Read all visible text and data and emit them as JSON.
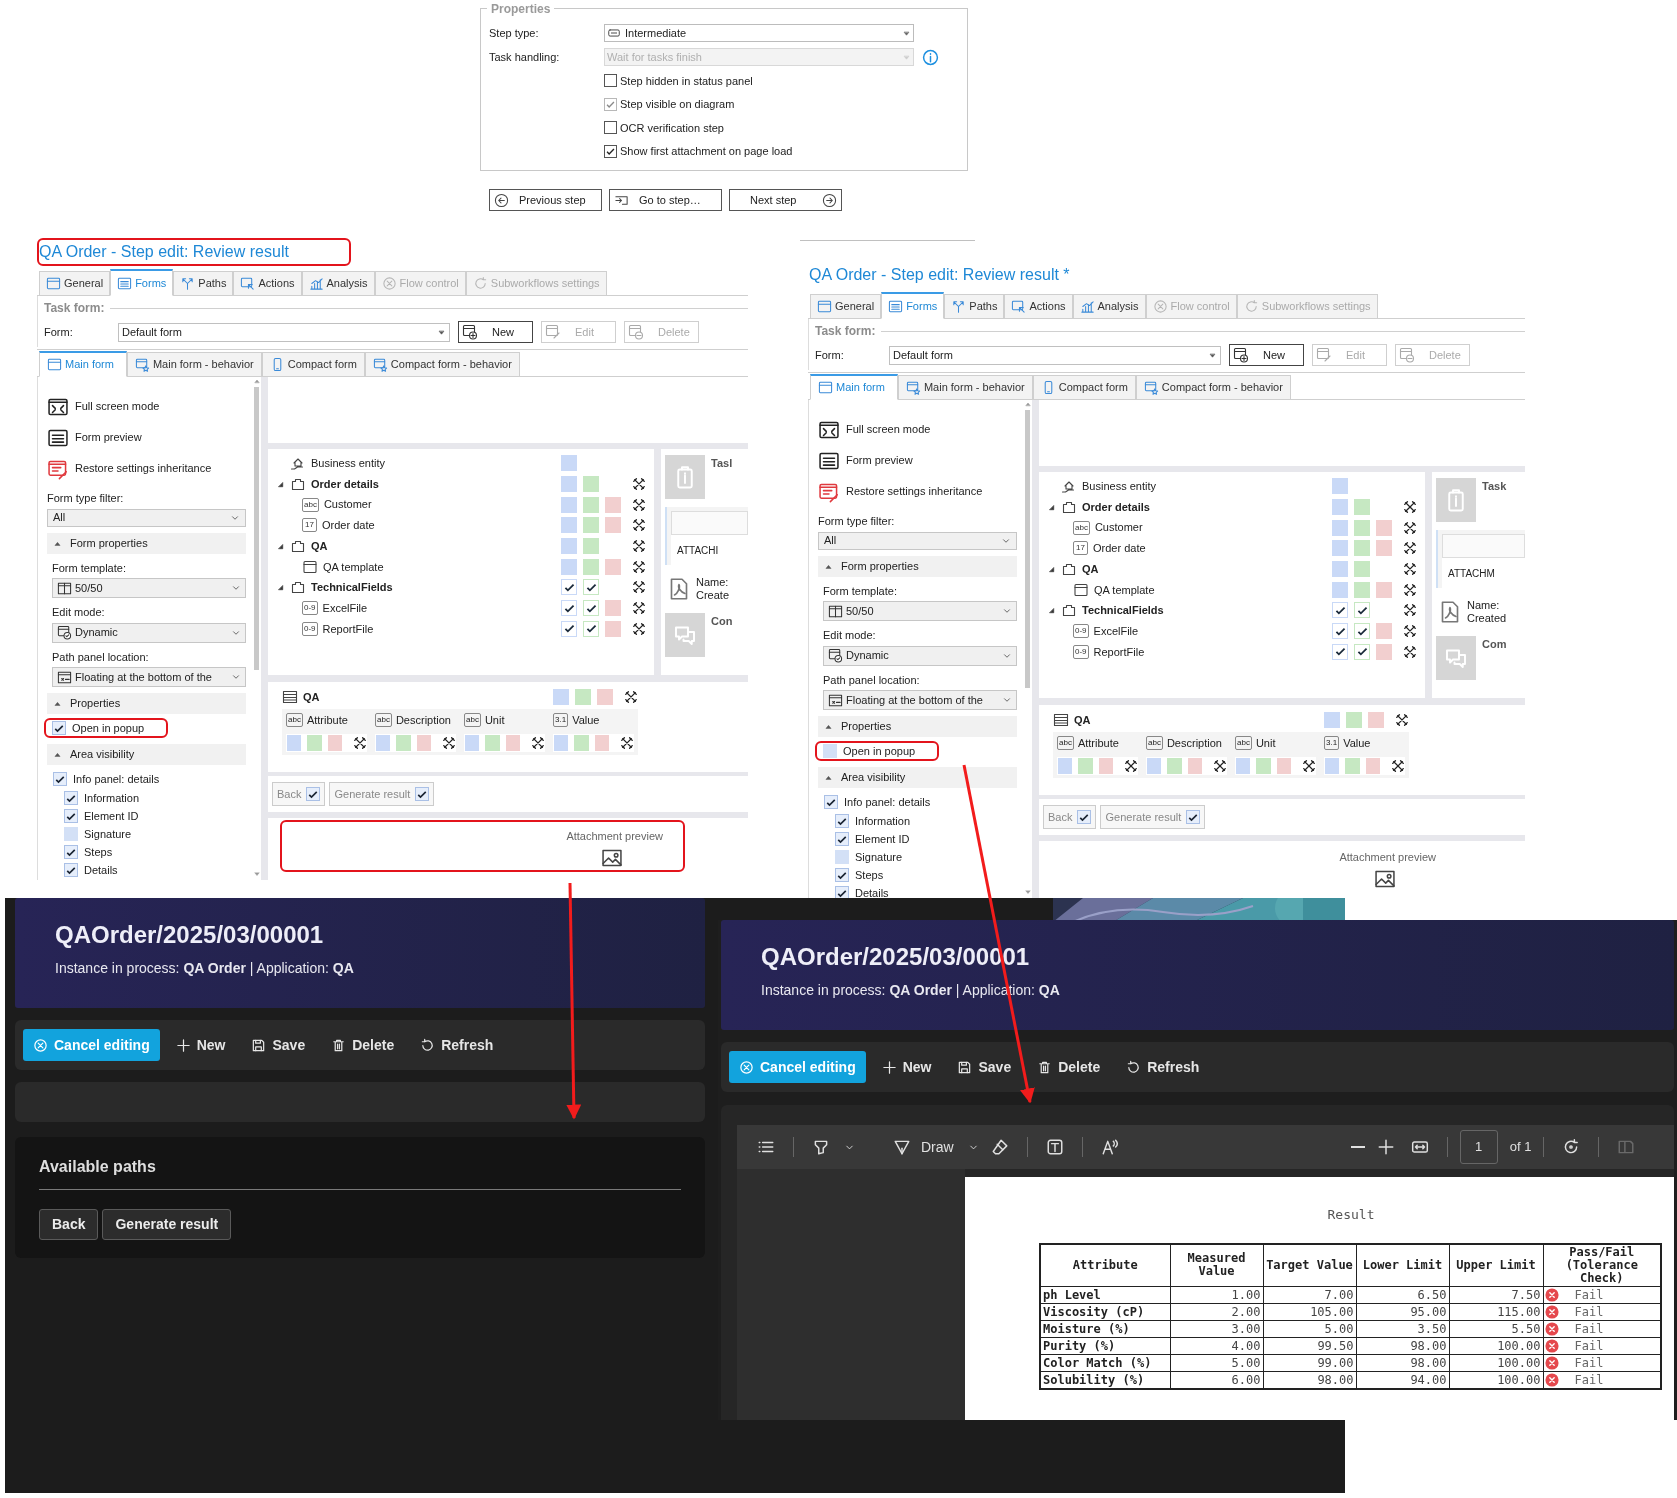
{
  "properties_panel": {
    "legend": "Properties",
    "fields": [
      {
        "label": "Step type:",
        "value": "Intermediate",
        "disabled": false,
        "info": false
      },
      {
        "label": "Task handling:",
        "value": "Wait for tasks finish",
        "disabled": true,
        "info": true
      }
    ],
    "checkboxes": [
      {
        "label": "Step hidden in status panel",
        "checked": false,
        "disabled": false
      },
      {
        "label": "Step visible on diagram",
        "checked": true,
        "disabled": true
      },
      {
        "label": "OCR verification step",
        "checked": false,
        "disabled": false
      },
      {
        "label": "Show first attachment on page load",
        "checked": true,
        "disabled": false
      }
    ],
    "buttons": [
      {
        "label": "Previous step",
        "kind": "prev"
      },
      {
        "label": "Go to step…",
        "kind": "goto"
      },
      {
        "label": "Next step",
        "kind": "next"
      }
    ]
  },
  "editor_panels": [
    {
      "title": "QA Order - Step edit: Review result",
      "title_highlighted": true,
      "tabs": [
        {
          "label": "General",
          "kind": "general",
          "selected": false,
          "disabled": false
        },
        {
          "label": "Forms",
          "kind": "forms",
          "selected": true,
          "disabled": false
        },
        {
          "label": "Paths",
          "kind": "paths",
          "selected": false,
          "disabled": false
        },
        {
          "label": "Actions",
          "kind": "actions",
          "selected": false,
          "disabled": false
        },
        {
          "label": "Analysis",
          "kind": "analysis",
          "selected": false,
          "disabled": false
        },
        {
          "label": "Flow control",
          "kind": "flow",
          "selected": false,
          "disabled": true
        },
        {
          "label": "Subworkflows settings",
          "kind": "subworkflows",
          "selected": false,
          "disabled": true
        }
      ],
      "task_form": {
        "heading": "Task form:",
        "label": "Form:",
        "value": "Default form",
        "buttons": [
          {
            "label": "New",
            "kind": "new",
            "disabled": false
          },
          {
            "label": "Edit",
            "kind": "edit",
            "disabled": true
          },
          {
            "label": "Delete",
            "kind": "delete",
            "disabled": true
          }
        ]
      },
      "subtabs": [
        {
          "label": "Main form",
          "kind": "main",
          "selected": true
        },
        {
          "label": "Main form - behavior",
          "kind": "behavior",
          "selected": false
        },
        {
          "label": "Compact form",
          "kind": "compact",
          "selected": false
        },
        {
          "label": "Compact form - behavior",
          "kind": "compact_behavior",
          "selected": false
        }
      ],
      "sidebar": {
        "actions": [
          {
            "label": "Full screen mode",
            "kind": "fullscreen"
          },
          {
            "label": "Form preview",
            "kind": "preview"
          },
          {
            "label": "Restore settings inheritance",
            "kind": "restore"
          }
        ],
        "filter": {
          "label": "Form type filter:",
          "value": "All"
        },
        "sections": [
          {
            "title": "Form properties",
            "expanded": true,
            "fields": [
              {
                "label": "Form template:",
                "value": "50/50",
                "kind": "template"
              },
              {
                "label": "Edit mode:",
                "value": "Dynamic",
                "kind": "mode"
              },
              {
                "label": "Path panel location:",
                "value": "Floating at the bottom of the",
                "kind": "location"
              }
            ]
          },
          {
            "title": "Properties",
            "expanded": true,
            "checks": [
              {
                "label": "Open in popup",
                "checked": true,
                "highlighted": true
              }
            ]
          },
          {
            "title": "Area visibility",
            "expanded": true,
            "checks": [
              {
                "label": "Info panel: details",
                "checked": true,
                "highlighted": false,
                "children": [
                  {
                    "label": "Information",
                    "checked": true
                  },
                  {
                    "label": "Element ID",
                    "checked": true
                  },
                  {
                    "label": "Signature",
                    "checked": false
                  },
                  {
                    "label": "Steps",
                    "checked": true
                  },
                  {
                    "label": "Details",
                    "checked": true
                  }
                ]
              }
            ]
          }
        ]
      },
      "fields_tree": [
        {
          "label": "Business entity",
          "kind": "entity",
          "tools": false,
          "flags": [
            {
              "color": "#c9d9f7",
              "checked": false
            }
          ]
        },
        {
          "label": "Order details",
          "kind": "group",
          "expanded": true,
          "tools": true,
          "flags": [
            {
              "color": "#c9d9f7",
              "checked": false
            },
            {
              "color": "#c6e8c2",
              "checked": false
            }
          ],
          "children": [
            {
              "label": "Customer",
              "kind": "field",
              "badge": "abc",
              "tools": true,
              "flags": [
                {
                  "color": "#c9d9f7",
                  "checked": false
                },
                {
                  "color": "#c6e8c2",
                  "checked": false
                },
                {
                  "color": "#f2cfcf",
                  "checked": false
                }
              ]
            },
            {
              "label": "Order date",
              "kind": "field",
              "badge": "17",
              "tools": true,
              "flags": [
                {
                  "color": "#c9d9f7",
                  "checked": false
                },
                {
                  "color": "#c6e8c2",
                  "checked": false
                },
                {
                  "color": "#f2cfcf",
                  "checked": false
                }
              ]
            }
          ]
        },
        {
          "label": "QA",
          "kind": "group",
          "expanded": true,
          "tools": true,
          "flags": [
            {
              "color": "#c9d9f7",
              "checked": false
            },
            {
              "color": "#c6e8c2",
              "checked": false
            }
          ],
          "children": [
            {
              "label": "QA template",
              "kind": "template",
              "tools": true,
              "flags": [
                {
                  "color": "#c9d9f7",
                  "checked": false
                },
                {
                  "color": "#c6e8c2",
                  "checked": false
                },
                {
                  "color": "#f2cfcf",
                  "checked": false
                }
              ]
            }
          ]
        },
        {
          "label": "TechnicalFields",
          "kind": "group",
          "expanded": true,
          "tools": true,
          "flags": [
            {
              "color": "#c9d9f7",
              "checked": true
            },
            {
              "color": "#c6e8c2",
              "checked": true
            }
          ],
          "children": [
            {
              "label": "ExcelFile",
              "kind": "field",
              "badge": "0-9",
              "tools": true,
              "flags": [
                {
                  "color": "#c9d9f7",
                  "checked": true
                },
                {
                  "color": "#c6e8c2",
                  "checked": true
                },
                {
                  "color": "#f2cfcf",
                  "checked": false
                }
              ]
            },
            {
              "label": "ReportFile",
              "kind": "field",
              "badge": "0-9",
              "tools": true,
              "flags": [
                {
                  "color": "#c9d9f7",
                  "checked": true
                },
                {
                  "color": "#c6e8c2",
                  "checked": true
                },
                {
                  "color": "#f2cfcf",
                  "checked": false
                }
              ]
            }
          ]
        }
      ],
      "info_panel": {
        "task_heading": "Tasl",
        "attachments_heading": "ATTACHI",
        "name_label": "Name:",
        "created_label": "Create",
        "comments_heading": "Con"
      },
      "qa_table": {
        "title": "QA",
        "tools": true,
        "flags": [
          {
            "color": "#c9d9f7",
            "checked": false
          },
          {
            "color": "#c6e8c2",
            "checked": false
          },
          {
            "color": "#f2cfcf",
            "checked": false
          }
        ],
        "columns": [
          {
            "label": "Attribute",
            "badge": "abc",
            "tools": true,
            "flags": [
              {
                "color": "#c9d9f7",
                "checked": false
              },
              {
                "color": "#c6e8c2",
                "checked": false
              },
              {
                "color": "#f2cfcf",
                "checked": false
              }
            ]
          },
          {
            "label": "Description",
            "badge": "abc",
            "tools": true,
            "flags": [
              {
                "color": "#c9d9f7",
                "checked": false
              },
              {
                "color": "#c6e8c2",
                "checked": false
              },
              {
                "color": "#f2cfcf",
                "checked": false
              }
            ]
          },
          {
            "label": "Unit",
            "badge": "abc",
            "tools": true,
            "flags": [
              {
                "color": "#c9d9f7",
                "checked": false
              },
              {
                "color": "#c6e8c2",
                "checked": false
              },
              {
                "color": "#f2cfcf",
                "checked": false
              }
            ]
          },
          {
            "label": "Value",
            "badge": "3.1",
            "tools": true,
            "flags": [
              {
                "color": "#c9d9f7",
                "checked": false
              },
              {
                "color": "#c6e8c2",
                "checked": false
              },
              {
                "color": "#f2cfcf",
                "checked": false
              }
            ]
          }
        ]
      },
      "path_buttons": [
        {
          "label": "Back",
          "checked": true
        },
        {
          "label": "Generate result",
          "checked": true
        }
      ],
      "attachment_preview": {
        "label": "Attachment preview",
        "highlighted": true
      }
    },
    {
      "title": "QA Order - Step edit: Review result *",
      "title_highlighted": false,
      "tabs": [
        {
          "label": "General",
          "kind": "general",
          "selected": false,
          "disabled": false
        },
        {
          "label": "Forms",
          "kind": "forms",
          "selected": true,
          "disabled": false
        },
        {
          "label": "Paths",
          "kind": "paths",
          "selected": false,
          "disabled": false
        },
        {
          "label": "Actions",
          "kind": "actions",
          "selected": false,
          "disabled": false
        },
        {
          "label": "Analysis",
          "kind": "analysis",
          "selected": false,
          "disabled": false
        },
        {
          "label": "Flow control",
          "kind": "flow",
          "selected": false,
          "disabled": true
        },
        {
          "label": "Subworkflows settings",
          "kind": "subworkflows",
          "selected": false,
          "disabled": true
        }
      ],
      "task_form": {
        "heading": "Task form:",
        "label": "Form:",
        "value": "Default form",
        "buttons": [
          {
            "label": "New",
            "kind": "new",
            "disabled": false
          },
          {
            "label": "Edit",
            "kind": "edit",
            "disabled": true
          },
          {
            "label": "Delete",
            "kind": "delete",
            "disabled": true
          }
        ]
      },
      "subtabs": [
        {
          "label": "Main form",
          "kind": "main",
          "selected": true
        },
        {
          "label": "Main form - behavior",
          "kind": "behavior",
          "selected": false
        },
        {
          "label": "Compact form",
          "kind": "compact",
          "selected": false
        },
        {
          "label": "Compact form - behavior",
          "kind": "compact_behavior",
          "selected": false
        }
      ],
      "sidebar": {
        "actions": [
          {
            "label": "Full screen mode",
            "kind": "fullscreen"
          },
          {
            "label": "Form preview",
            "kind": "preview"
          },
          {
            "label": "Restore settings inheritance",
            "kind": "restore"
          }
        ],
        "filter": {
          "label": "Form type filter:",
          "value": "All"
        },
        "sections": [
          {
            "title": "Form properties",
            "expanded": true,
            "fields": [
              {
                "label": "Form template:",
                "value": "50/50",
                "kind": "template"
              },
              {
                "label": "Edit mode:",
                "value": "Dynamic",
                "kind": "mode"
              },
              {
                "label": "Path panel location:",
                "value": "Floating at the bottom of the",
                "kind": "location"
              }
            ]
          },
          {
            "title": "Properties",
            "expanded": true,
            "checks": [
              {
                "label": "Open in popup",
                "checked": false,
                "highlighted": true
              }
            ]
          },
          {
            "title": "Area visibility",
            "expanded": true,
            "checks": [
              {
                "label": "Info panel: details",
                "checked": true,
                "highlighted": false,
                "children": [
                  {
                    "label": "Information",
                    "checked": true
                  },
                  {
                    "label": "Element ID",
                    "checked": true
                  },
                  {
                    "label": "Signature",
                    "checked": false
                  },
                  {
                    "label": "Steps",
                    "checked": true
                  },
                  {
                    "label": "Details",
                    "checked": true
                  }
                ]
              }
            ]
          }
        ]
      },
      "fields_tree": [
        {
          "label": "Business entity",
          "kind": "entity",
          "tools": false,
          "flags": [
            {
              "color": "#c9d9f7",
              "checked": false
            }
          ]
        },
        {
          "label": "Order details",
          "kind": "group",
          "expanded": true,
          "tools": true,
          "flags": [
            {
              "color": "#c9d9f7",
              "checked": false
            },
            {
              "color": "#c6e8c2",
              "checked": false
            }
          ],
          "children": [
            {
              "label": "Customer",
              "kind": "field",
              "badge": "abc",
              "tools": true,
              "flags": [
                {
                  "color": "#c9d9f7",
                  "checked": false
                },
                {
                  "color": "#c6e8c2",
                  "checked": false
                },
                {
                  "color": "#f2cfcf",
                  "checked": false
                }
              ]
            },
            {
              "label": "Order date",
              "kind": "field",
              "badge": "17",
              "tools": true,
              "flags": [
                {
                  "color": "#c9d9f7",
                  "checked": false
                },
                {
                  "color": "#c6e8c2",
                  "checked": false
                },
                {
                  "color": "#f2cfcf",
                  "checked": false
                }
              ]
            }
          ]
        },
        {
          "label": "QA",
          "kind": "group",
          "expanded": true,
          "tools": true,
          "flags": [
            {
              "color": "#c9d9f7",
              "checked": false
            },
            {
              "color": "#c6e8c2",
              "checked": false
            }
          ],
          "children": [
            {
              "label": "QA template",
              "kind": "template",
              "tools": true,
              "flags": [
                {
                  "color": "#c9d9f7",
                  "checked": false
                },
                {
                  "color": "#c6e8c2",
                  "checked": false
                },
                {
                  "color": "#f2cfcf",
                  "checked": false
                }
              ]
            }
          ]
        },
        {
          "label": "TechnicalFields",
          "kind": "group",
          "expanded": true,
          "tools": true,
          "flags": [
            {
              "color": "#c9d9f7",
              "checked": true
            },
            {
              "color": "#c6e8c2",
              "checked": true
            }
          ],
          "children": [
            {
              "label": "ExcelFile",
              "kind": "field",
              "badge": "0-9",
              "tools": true,
              "flags": [
                {
                  "color": "#c9d9f7",
                  "checked": true
                },
                {
                  "color": "#c6e8c2",
                  "checked": true
                },
                {
                  "color": "#f2cfcf",
                  "checked": false
                }
              ]
            },
            {
              "label": "ReportFile",
              "kind": "field",
              "badge": "0-9",
              "tools": true,
              "flags": [
                {
                  "color": "#c9d9f7",
                  "checked": true
                },
                {
                  "color": "#c6e8c2",
                  "checked": true
                },
                {
                  "color": "#f2cfcf",
                  "checked": false
                }
              ]
            }
          ]
        }
      ],
      "info_panel": {
        "task_heading": "Task",
        "attachments_heading": "ATTACHM",
        "name_label": "Name:",
        "created_label": "Created",
        "comments_heading": "Com"
      },
      "qa_table": {
        "title": "QA",
        "tools": true,
        "flags": [
          {
            "color": "#c9d9f7",
            "checked": false
          },
          {
            "color": "#c6e8c2",
            "checked": false
          },
          {
            "color": "#f2cfcf",
            "checked": false
          }
        ],
        "columns": [
          {
            "label": "Attribute",
            "badge": "abc",
            "tools": true,
            "flags": [
              {
                "color": "#c9d9f7",
                "checked": false
              },
              {
                "color": "#c6e8c2",
                "checked": false
              },
              {
                "color": "#f2cfcf",
                "checked": false
              }
            ]
          },
          {
            "label": "Description",
            "badge": "abc",
            "tools": true,
            "flags": [
              {
                "color": "#c9d9f7",
                "checked": false
              },
              {
                "color": "#c6e8c2",
                "checked": false
              },
              {
                "color": "#f2cfcf",
                "checked": false
              }
            ]
          },
          {
            "label": "Unit",
            "badge": "abc",
            "tools": true,
            "flags": [
              {
                "color": "#c9d9f7",
                "checked": false
              },
              {
                "color": "#c6e8c2",
                "checked": false
              },
              {
                "color": "#f2cfcf",
                "checked": false
              }
            ]
          },
          {
            "label": "Value",
            "badge": "3.1",
            "tools": true,
            "flags": [
              {
                "color": "#c9d9f7",
                "checked": false
              },
              {
                "color": "#c6e8c2",
                "checked": false
              },
              {
                "color": "#f2cfcf",
                "checked": false
              }
            ]
          }
        ]
      },
      "path_buttons": [
        {
          "label": "Back",
          "checked": true
        },
        {
          "label": "Generate result",
          "checked": true
        }
      ],
      "attachment_preview": {
        "label": "Attachment preview",
        "highlighted": false
      }
    }
  ],
  "dark_screens": [
    {
      "title": "QAOrder/2025/03/00001",
      "subtitle": "Instance in process: **QA Order** | Application: **QA**",
      "actions": [
        {
          "label": "Cancel editing",
          "kind": "cancel",
          "primary": true
        },
        {
          "label": "New",
          "kind": "new",
          "primary": false
        },
        {
          "label": "Save",
          "kind": "save",
          "primary": false
        },
        {
          "label": "Delete",
          "kind": "delete",
          "primary": false
        },
        {
          "label": "Refresh",
          "kind": "refresh",
          "primary": false
        }
      ],
      "paths": {
        "title": "Available paths",
        "buttons": [
          "Back",
          "Generate result"
        ]
      }
    },
    {
      "title": "QAOrder/2025/03/00001",
      "subtitle": "Instance in process: **QA Order** | Application: **QA**",
      "actions": [
        {
          "label": "Cancel editing",
          "kind": "cancel",
          "primary": true
        },
        {
          "label": "New",
          "kind": "new",
          "primary": false
        },
        {
          "label": "Save",
          "kind": "save",
          "primary": false
        },
        {
          "label": "Delete",
          "kind": "delete",
          "primary": false
        },
        {
          "label": "Refresh",
          "kind": "refresh",
          "primary": false
        }
      ],
      "viewer": {
        "tools": [
          {
            "kind": "contents"
          },
          {
            "kind": "highlight"
          },
          {
            "kind": "draw",
            "label": "Draw"
          },
          {
            "kind": "erase"
          },
          {
            "kind": "textbox"
          },
          {
            "kind": "read"
          },
          {
            "kind": "zoom_out"
          },
          {
            "kind": "zoom_in"
          },
          {
            "kind": "fit"
          },
          {
            "kind": "page",
            "value": "1",
            "label": "of 1"
          },
          {
            "kind": "rotate"
          },
          {
            "kind": "view"
          }
        ],
        "document": {
          "title": "Result",
          "columns": [
            "Attribute",
            "Measured Value",
            "Target Value",
            "Lower Limit",
            "Upper Limit",
            "Pass/Fail (Tolerance Check)"
          ],
          "rows": [
            {
              "cells": [
                "ph Level",
                "1.00",
                "7.00",
                "6.50",
                "7.50"
              ],
              "result": "Fail",
              "passed": false
            },
            {
              "cells": [
                "Viscosity (cP)",
                "2.00",
                "105.00",
                "95.00",
                "115.00"
              ],
              "result": "Fail",
              "passed": false
            },
            {
              "cells": [
                "Moisture (%)",
                "3.00",
                "5.00",
                "3.50",
                "5.50"
              ],
              "result": "Fail",
              "passed": false
            },
            {
              "cells": [
                "Purity (%)",
                "4.00",
                "99.50",
                "98.00",
                "100.00"
              ],
              "result": "Fail",
              "passed": false
            },
            {
              "cells": [
                "Color Match (%)",
                "5.00",
                "99.00",
                "98.00",
                "100.00"
              ],
              "result": "Fail",
              "passed": false
            },
            {
              "cells": [
                "Solubility (%)",
                "6.00",
                "98.00",
                "94.00",
                "100.00"
              ],
              "result": "Fail",
              "passed": false
            }
          ]
        }
      }
    }
  ]
}
